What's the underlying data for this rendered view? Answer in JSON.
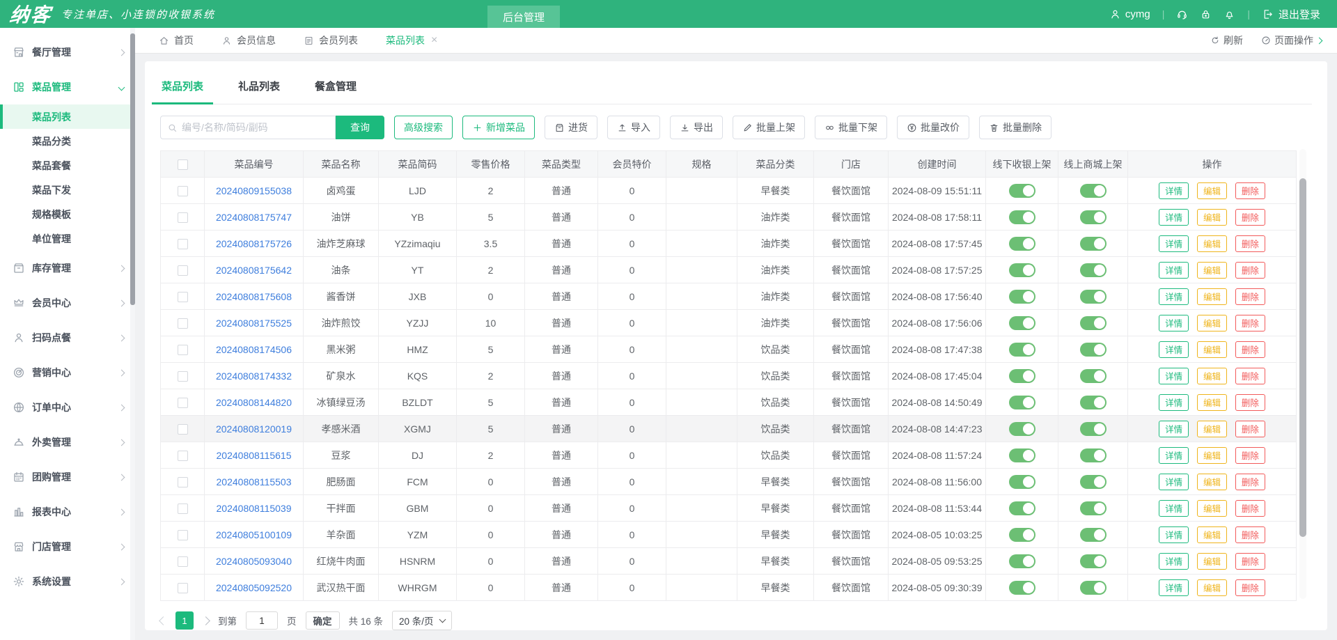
{
  "colors": {
    "brand_green": "#2fb37d",
    "accent": "#1cba7d",
    "toggle_on": "#6cbf74",
    "link_blue": "#3e7edd",
    "edit_yellow": "#efb41b",
    "delete_red": "#f25a5a"
  },
  "header": {
    "logo": "纳客",
    "slogan": "专注单店、小连锁的收银系统",
    "nav_tab": "后台管理",
    "username": "cymg",
    "logout_label": "退出登录"
  },
  "tabbar": {
    "tabs": [
      {
        "label": "首页",
        "icon": "home",
        "name": "tab-home"
      },
      {
        "label": "会员信息",
        "icon": "user",
        "name": "tab-member-info"
      },
      {
        "label": "会员列表",
        "icon": "doc",
        "name": "tab-member-list"
      },
      {
        "label": "菜品列表",
        "cls": "active closable",
        "name": "tab-dish-list"
      }
    ],
    "refresh_label": "刷新",
    "page_ops_label": "页面操作"
  },
  "sidebar": {
    "items": [
      {
        "label": "餐厅管理",
        "icon": "restaurant",
        "cls": "parent chev-right",
        "name": "sidebar-item-restaurant"
      },
      {
        "label": "菜品管理",
        "icon": "dishes",
        "cls": "parent active chev-down",
        "name": "sidebar-item-dish-mgmt"
      },
      {
        "label": "菜品列表",
        "cls": "child selected",
        "name": "sidebar-item-dish-list"
      },
      {
        "label": "菜品分类",
        "cls": "child",
        "name": "sidebar-item-dish-category"
      },
      {
        "label": "菜品套餐",
        "cls": "child",
        "name": "sidebar-item-dish-combo"
      },
      {
        "label": "菜品下发",
        "cls": "child",
        "name": "sidebar-item-dish-dispatch"
      },
      {
        "label": "规格模板",
        "cls": "child",
        "name": "sidebar-item-spec-template"
      },
      {
        "label": "单位管理",
        "cls": "child",
        "name": "sidebar-item-unit-mgmt"
      },
      {
        "label": "库存管理",
        "icon": "inventory",
        "cls": "parent chev-right",
        "name": "sidebar-item-inventory"
      },
      {
        "label": "会员中心",
        "icon": "crown",
        "cls": "parent chev-right",
        "name": "sidebar-item-member-center"
      },
      {
        "label": "扫码点餐",
        "icon": "person",
        "cls": "parent chev-right",
        "name": "sidebar-item-scan-order"
      },
      {
        "label": "营销中心",
        "icon": "target",
        "cls": "parent chev-right",
        "name": "sidebar-item-marketing"
      },
      {
        "label": "订单中心",
        "icon": "globe",
        "cls": "parent chev-right",
        "name": "sidebar-item-order-center"
      },
      {
        "label": "外卖管理",
        "icon": "cloche",
        "cls": "parent chev-right",
        "name": "sidebar-item-takeout"
      },
      {
        "label": "团购管理",
        "icon": "calendar",
        "cls": "parent chev-right",
        "name": "sidebar-item-groupbuy"
      },
      {
        "label": "报表中心",
        "icon": "chart",
        "cls": "parent chev-right",
        "name": "sidebar-item-reports"
      },
      {
        "label": "门店管理",
        "icon": "store",
        "cls": "parent chev-right",
        "name": "sidebar-item-store-mgmt"
      },
      {
        "label": "系统设置",
        "icon": "gear",
        "cls": "parent chev-right",
        "name": "sidebar-item-settings"
      }
    ]
  },
  "content": {
    "tabs": [
      {
        "label": "菜品列表",
        "cls": "active",
        "name": "content-tab-dish-list"
      },
      {
        "label": "礼品列表",
        "name": "content-tab-gift-list"
      },
      {
        "label": "餐盒管理",
        "name": "content-tab-mealbox"
      }
    ],
    "toolbar": {
      "search_placeholder": "编号/名称/简码/副码",
      "search_value": "",
      "search_button": "查询",
      "buttons": [
        {
          "label": "高级搜索",
          "cls": "btn-green",
          "name": "advanced-search-button"
        },
        {
          "label": "新增菜品",
          "cls": "btn-green",
          "icon": "plus",
          "name": "add-dish-button"
        },
        {
          "label": "进货",
          "icon": "box",
          "name": "purchase-button"
        },
        {
          "label": "导入",
          "icon": "upload",
          "name": "import-button"
        },
        {
          "label": "导出",
          "icon": "download",
          "name": "export-button"
        },
        {
          "label": "批量上架",
          "icon": "pencil",
          "name": "batch-onshelf-button"
        },
        {
          "label": "批量下架",
          "icon": "chain",
          "name": "batch-offshelf-button"
        },
        {
          "label": "批量改价",
          "icon": "yen",
          "name": "batch-reprice-button"
        },
        {
          "label": "批量删除",
          "icon": "trash",
          "name": "batch-delete-button"
        }
      ]
    },
    "table": {
      "columns": [
        "菜品编号",
        "菜品名称",
        "菜品简码",
        "零售价格",
        "菜品类型",
        "会员特价",
        "规格",
        "菜品分类",
        "门店",
        "创建时间",
        "线下收银上架",
        "线上商城上架",
        "操作"
      ],
      "actions": [
        "详情",
        "编辑",
        "删除"
      ],
      "rows": [
        {
          "code": "20240809155038",
          "name": "卤鸡蛋",
          "short": "LJD",
          "price": "2",
          "type": "普通",
          "vip": "0",
          "spec": "",
          "category": "早餐类",
          "store": "餐饮面馆",
          "created": "2024-08-09 15:51:11"
        },
        {
          "code": "20240808175747",
          "name": "油饼",
          "short": "YB",
          "price": "5",
          "type": "普通",
          "vip": "0",
          "spec": "",
          "category": "油炸类",
          "store": "餐饮面馆",
          "created": "2024-08-08 17:58:11"
        },
        {
          "code": "20240808175726",
          "name": "油炸芝麻球",
          "short": "YZzimaqiu",
          "price": "3.5",
          "type": "普通",
          "vip": "0",
          "spec": "",
          "category": "油炸类",
          "store": "餐饮面馆",
          "created": "2024-08-08 17:57:45"
        },
        {
          "code": "20240808175642",
          "name": "油条",
          "short": "YT",
          "price": "2",
          "type": "普通",
          "vip": "0",
          "spec": "",
          "category": "油炸类",
          "store": "餐饮面馆",
          "created": "2024-08-08 17:57:25"
        },
        {
          "code": "20240808175608",
          "name": "酱香饼",
          "short": "JXB",
          "price": "0",
          "type": "普通",
          "vip": "0",
          "spec": "",
          "category": "油炸类",
          "store": "餐饮面馆",
          "created": "2024-08-08 17:56:40"
        },
        {
          "code": "20240808175525",
          "name": "油炸煎饺",
          "short": "YZJJ",
          "price": "10",
          "type": "普通",
          "vip": "0",
          "spec": "",
          "category": "油炸类",
          "store": "餐饮面馆",
          "created": "2024-08-08 17:56:06"
        },
        {
          "code": "20240808174506",
          "name": "黑米粥",
          "short": "HMZ",
          "price": "5",
          "type": "普通",
          "vip": "0",
          "spec": "",
          "category": "饮品类",
          "store": "餐饮面馆",
          "created": "2024-08-08 17:47:38"
        },
        {
          "code": "20240808174332",
          "name": "矿泉水",
          "short": "KQS",
          "price": "2",
          "type": "普通",
          "vip": "0",
          "spec": "",
          "category": "饮品类",
          "store": "餐饮面馆",
          "created": "2024-08-08 17:45:04"
        },
        {
          "code": "20240808144820",
          "name": "冰镇绿豆汤",
          "short": "BZLDT",
          "price": "5",
          "type": "普通",
          "vip": "0",
          "spec": "",
          "category": "饮品类",
          "store": "餐饮面馆",
          "created": "2024-08-08 14:50:49"
        },
        {
          "code": "20240808120019",
          "name": "孝感米酒",
          "short": "XGMJ",
          "price": "5",
          "type": "普通",
          "vip": "0",
          "spec": "",
          "category": "饮品类",
          "store": "餐饮面馆",
          "created": "2024-08-08 14:47:23",
          "cls": "hl"
        },
        {
          "code": "20240808115615",
          "name": "豆浆",
          "short": "DJ",
          "price": "2",
          "type": "普通",
          "vip": "0",
          "spec": "",
          "category": "饮品类",
          "store": "餐饮面馆",
          "created": "2024-08-08 11:57:24"
        },
        {
          "code": "20240808115503",
          "name": "肥肠面",
          "short": "FCM",
          "price": "0",
          "type": "普通",
          "vip": "0",
          "spec": "",
          "category": "早餐类",
          "store": "餐饮面馆",
          "created": "2024-08-08 11:56:00"
        },
        {
          "code": "20240808115039",
          "name": "干拌面",
          "short": "GBM",
          "price": "0",
          "type": "普通",
          "vip": "0",
          "spec": "",
          "category": "早餐类",
          "store": "餐饮面馆",
          "created": "2024-08-08 11:53:44"
        },
        {
          "code": "20240805100109",
          "name": "羊杂面",
          "short": "YZM",
          "price": "0",
          "type": "普通",
          "vip": "0",
          "spec": "",
          "category": "早餐类",
          "store": "餐饮面馆",
          "created": "2024-08-05 10:03:25"
        },
        {
          "code": "20240805093040",
          "name": "红烧牛肉面",
          "short": "HSNRM",
          "price": "0",
          "type": "普通",
          "vip": "0",
          "spec": "",
          "category": "早餐类",
          "store": "餐饮面馆",
          "created": "2024-08-05 09:53:25"
        },
        {
          "code": "20240805092520",
          "name": "武汉热干面",
          "short": "WHRGM",
          "price": "0",
          "type": "普通",
          "vip": "0",
          "spec": "",
          "category": "早餐类",
          "store": "餐饮面馆",
          "created": "2024-08-05 09:30:39"
        }
      ]
    },
    "pagination": {
      "current_page": "1",
      "goto_label": "到第",
      "goto_value": "1",
      "page_label": "页",
      "confirm_label": "确定",
      "total_label": "共 16 条",
      "page_size": "20 条/页"
    }
  }
}
